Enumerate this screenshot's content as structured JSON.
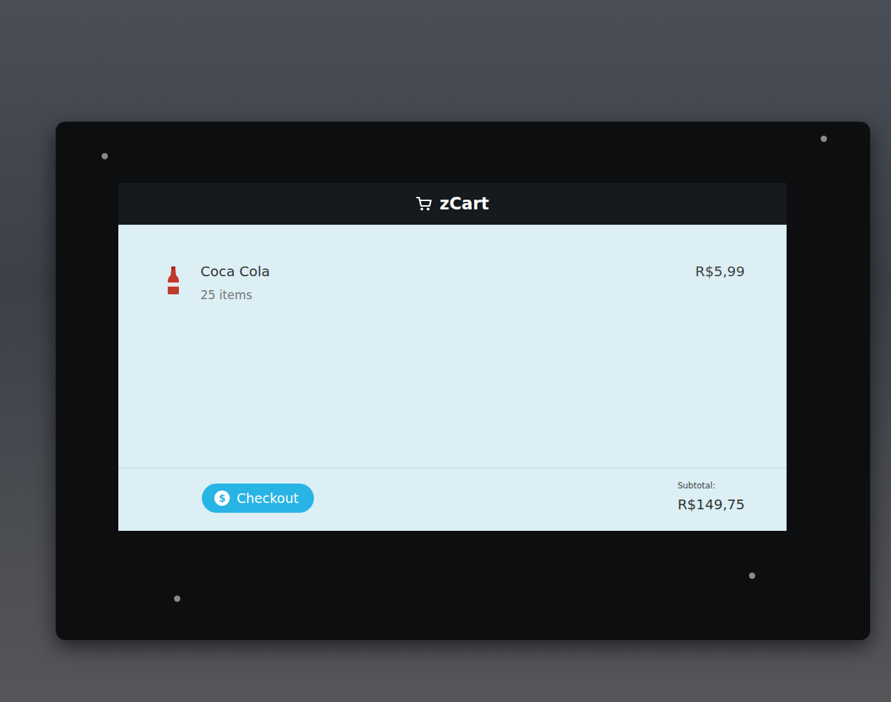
{
  "window": {
    "title": "zCart"
  },
  "cart": {
    "items": [
      {
        "name": "Coca Cola",
        "count": "25 items",
        "price": "R$5,99"
      }
    ]
  },
  "footer": {
    "subtotal_label": "Subtotal:",
    "subtotal": "R$149,75",
    "checkout": {
      "label": "Checkout",
      "icon": "$"
    }
  }
}
